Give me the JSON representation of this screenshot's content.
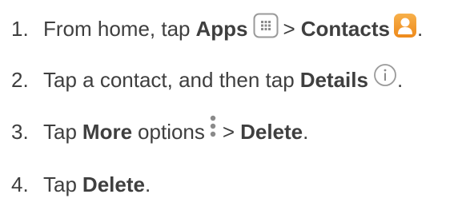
{
  "steps": [
    {
      "number": "1.",
      "prefix": "From home, tap",
      "apps_label": "Apps",
      "separator": ">",
      "contacts_label": "Contacts",
      "suffix": ".",
      "icons": [
        "apps-grid-icon",
        "contacts-icon"
      ]
    },
    {
      "number": "2.",
      "prefix": "Tap a contact, and then tap",
      "details_label": "Details",
      "suffix": ".",
      "icons": [
        "info-icon"
      ]
    },
    {
      "number": "3.",
      "prefix": "Tap",
      "more_label": "More",
      "options_label": "options",
      "separator": ">",
      "delete_label": "Delete",
      "suffix": ".",
      "icons": [
        "more-options-icon"
      ]
    },
    {
      "number": "4.",
      "prefix": "Tap",
      "delete_label": "Delete",
      "suffix": "."
    }
  ],
  "colors": {
    "text": "#3f3f3f",
    "icon_gray": "#9a9a9a",
    "contacts_orange": "#f39a2b"
  }
}
